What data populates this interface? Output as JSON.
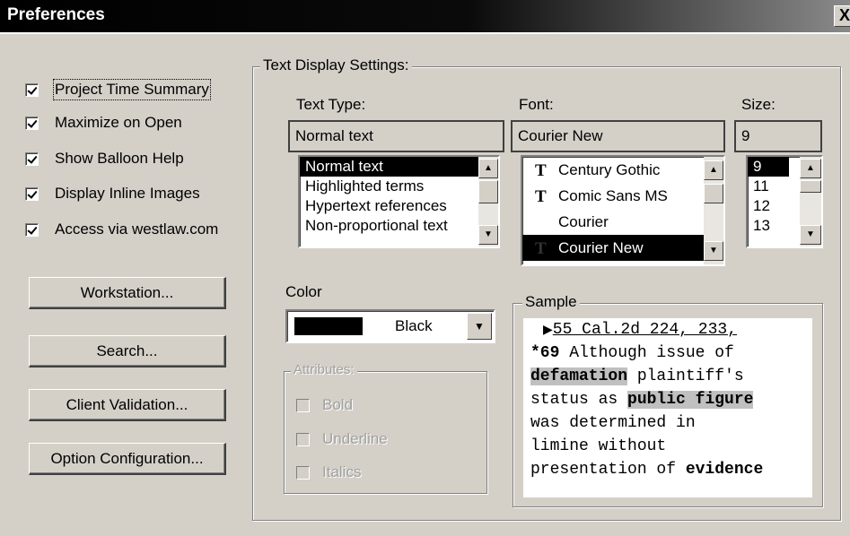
{
  "window": {
    "title": "Preferences",
    "close": "X"
  },
  "options": [
    {
      "label": "Project Time Summary",
      "checked": true
    },
    {
      "label": "Maximize on Open",
      "checked": true
    },
    {
      "label": "Show Balloon Help",
      "checked": true
    },
    {
      "label": "Display Inline Images",
      "checked": true
    },
    {
      "label": "Access via westlaw.com",
      "checked": true
    }
  ],
  "buttons": {
    "workstation": "Workstation...",
    "search": "Search...",
    "client_validation": "Client Validation...",
    "option_configuration": "Option Configuration..."
  },
  "text_display": {
    "group_title": "Text Display Settings:",
    "text_type": {
      "label": "Text Type:",
      "value": "Normal text",
      "items": [
        "Normal text",
        "Highlighted terms",
        "Hypertext references",
        "Non-proportional text"
      ],
      "selected": "Normal text"
    },
    "font": {
      "label": "Font:",
      "value": "Courier New",
      "icon": "truetype-icon",
      "items": [
        "Century Gothic",
        "Comic Sans MS",
        "Courier",
        "Courier New"
      ],
      "selected": "Courier New"
    },
    "size": {
      "label": "Size:",
      "value": "9",
      "items": [
        "9",
        "11",
        "12",
        "13"
      ],
      "selected": "9"
    },
    "color": {
      "label": "Color",
      "value": "Black",
      "swatch": "#000000"
    },
    "attributes": {
      "group_title": "Attributes:",
      "bold": "Bold",
      "underline": "Underline",
      "italics": "Italics"
    },
    "sample": {
      "group_title": "Sample",
      "line1_marker": "▶",
      "line1": "55 Cal.2d 224, 233,",
      "line2_star": "*69",
      "line2_rest": " Although issue of",
      "line3_hl": "defamation",
      "line3_rest": " plaintiff's",
      "line4_a": "status as ",
      "line4_hl": "public figure",
      "line5": "was determined in",
      "line6": "limine without",
      "line7_a": "presentation of ",
      "line7_b": "evidence"
    }
  }
}
